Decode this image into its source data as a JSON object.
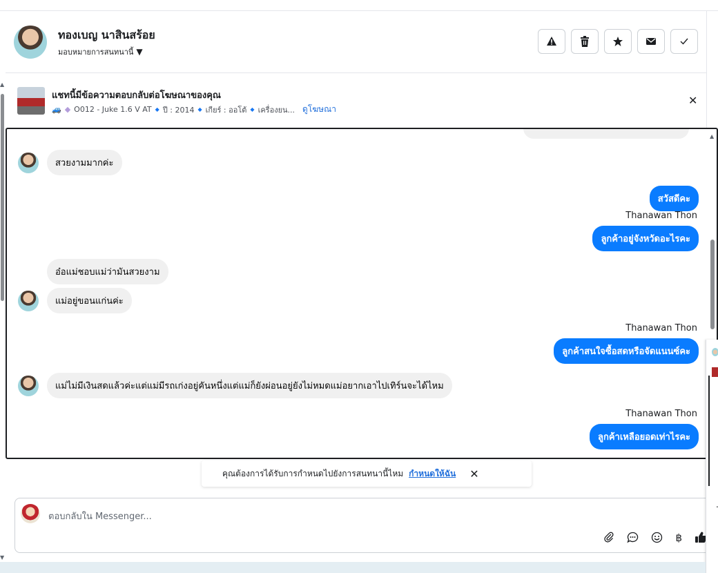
{
  "header": {
    "contact_name": "ทองเบญ นาสินสร้อย",
    "assign_label": "มอบหมายการสนทนานี้",
    "actions": [
      "spam",
      "delete",
      "star",
      "mark-unread",
      "done"
    ]
  },
  "ad": {
    "title": "แชทนี้มีข้อความตอบกลับต่อโฆษณาของคุณ",
    "car_code": "O012 - Juke 1.6 V AT",
    "year": "ปี : 2014",
    "gear": "เกียร์ : ออโต้",
    "engine": "เครื่องยน...",
    "view_link": "ดูโฆษณา"
  },
  "messages": [
    {
      "dir": "in",
      "text": "สวยงามมากค่ะ"
    },
    {
      "dir": "out",
      "text": "สวัสดีคะ"
    },
    {
      "dir": "out",
      "sender": "Thanawan Thon",
      "text": "ลูกค้าอยู่จังหวัดอะไรคะ"
    },
    {
      "dir": "in",
      "text": "อ๋อแม่ชอบแม่ว่ามันสวยงาม"
    },
    {
      "dir": "in",
      "text": "แม่อยู่ขอนแก่นค่ะ"
    },
    {
      "dir": "out",
      "sender": "Thanawan Thon",
      "text": "ลูกค้าสนใจซื้อสดหรือจัดแนนซ์คะ"
    },
    {
      "dir": "in",
      "text": "แม่ไม่มีเงินสดแล้วค่ะแต่แม่มีรถเก่งอยู่คันหนึ่งแต่แม่ก็ยังผ่อนอยู่ยังไม่หมดแม่อยากเอาไปเทิร์นจะได้ไหม"
    },
    {
      "dir": "out",
      "sender": "Thanawan Thon",
      "text": "ลูกค้าเหลือยอดเท่าไรคะ"
    }
  ],
  "suggestion": {
    "text": "คุณต้องการได้รับการกำหนดไปยังการสนทนานี้ไหม",
    "link": "กำหนดให้ฉัน"
  },
  "composer": {
    "placeholder": "ตอบกลับใน Messenger...",
    "tools": [
      "attach-icon",
      "saved-reply-icon",
      "emoji-icon",
      "baht-icon",
      "like-icon"
    ]
  },
  "colors": {
    "outgoing_bubble": "#0a7cff",
    "incoming_bubble": "#f0f0f0",
    "link": "#216fdb"
  }
}
